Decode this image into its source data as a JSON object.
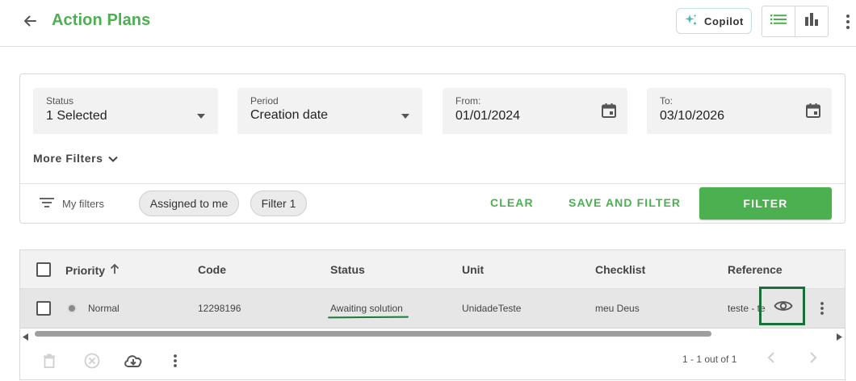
{
  "header": {
    "title": "Action Plans",
    "copilot_label": "Copilot"
  },
  "filters": {
    "status": {
      "label": "Status",
      "value": "1 Selected"
    },
    "period": {
      "label": "Period",
      "value": "Creation date"
    },
    "from": {
      "label": "From:",
      "value": "01/01/2024"
    },
    "to": {
      "label": "To:",
      "value": "03/10/2026"
    },
    "more_filters_label": "More Filters",
    "my_filters_label": "My filters",
    "chips": [
      "Assigned to me",
      "Filter 1"
    ],
    "clear_label": "CLEAR",
    "save_and_filter_label": "SAVE AND FILTER",
    "filter_label": "FILTER"
  },
  "table": {
    "columns": [
      "Priority",
      "Code",
      "Status",
      "Unit",
      "Checklist",
      "Reference"
    ],
    "rows": [
      {
        "priority": "Normal",
        "code": "12298196",
        "status": "Awaiting solution",
        "unit": "UnidadeTeste",
        "checklist": "meu Deus",
        "reference": "teste - te"
      }
    ],
    "pagination_text": "1 - 1 out of 1"
  },
  "colors": {
    "accent": "#4caf50",
    "highlight": "#1b6e3a"
  }
}
